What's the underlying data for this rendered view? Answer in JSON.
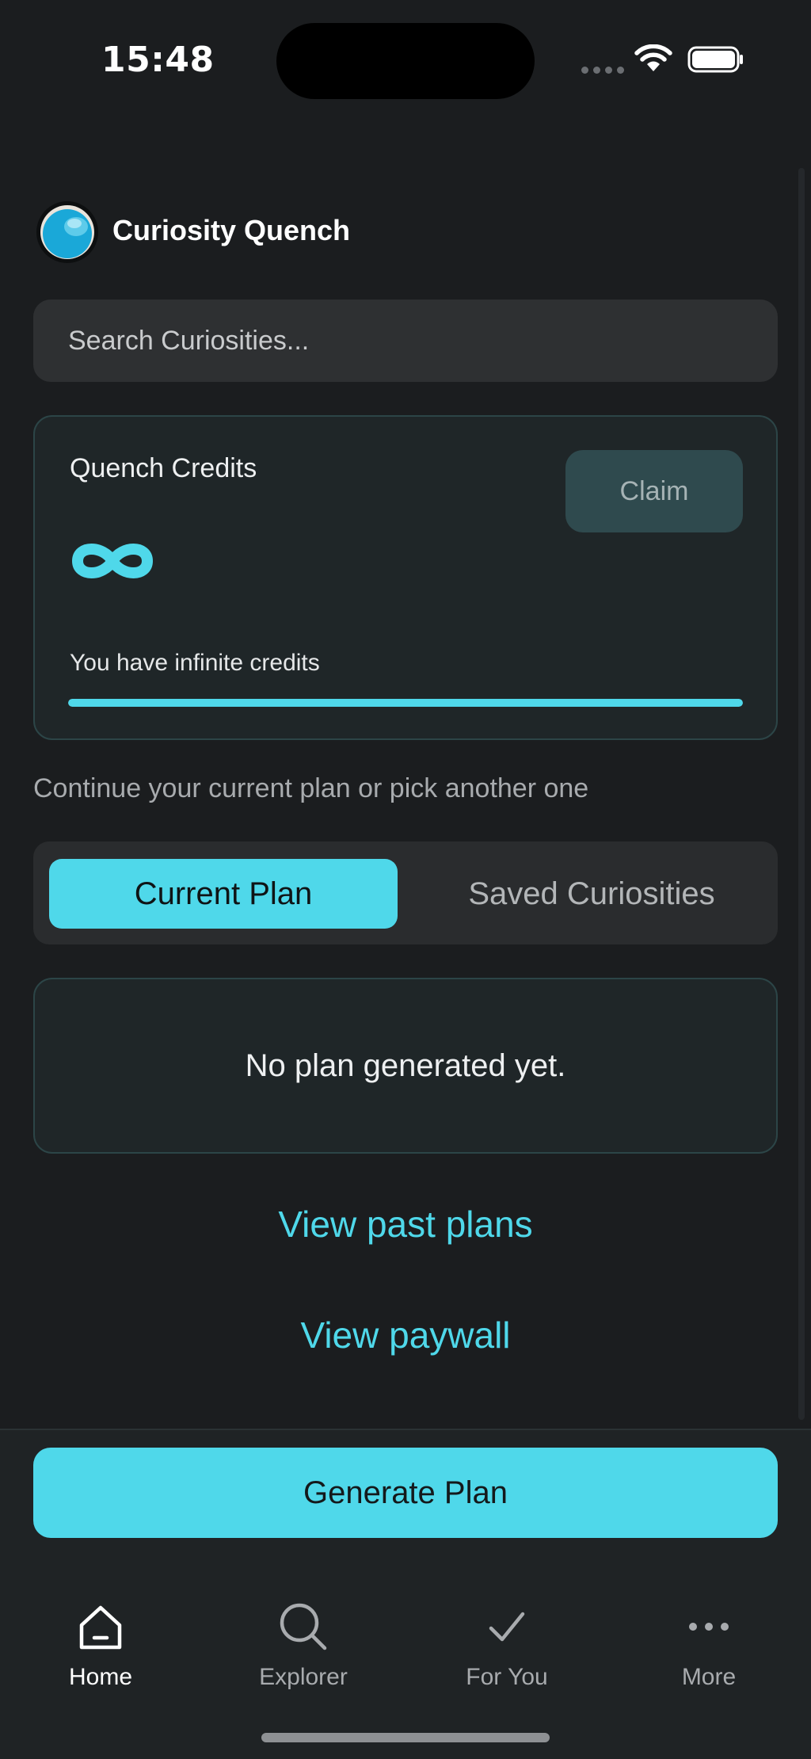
{
  "status_bar": {
    "time": "15:48"
  },
  "header": {
    "app_name": "Curiosity Quench",
    "logo_icon": "water-drop-icon"
  },
  "search": {
    "placeholder": "Search Curiosities..."
  },
  "credits": {
    "label": "Quench Credits",
    "claim_label": "Claim",
    "symbol_icon": "infinity-icon",
    "status_text": "You have infinite credits",
    "progress_fraction": 1.0
  },
  "plan_section": {
    "subtitle": "Continue your current plan or pick another one",
    "tabs": [
      {
        "label": "Current Plan",
        "active": true
      },
      {
        "label": "Saved Curiosities",
        "active": false
      }
    ],
    "empty_message": "No plan generated yet."
  },
  "links": {
    "past_plans": "View past plans",
    "paywall": "View paywall"
  },
  "actions": {
    "generate_label": "Generate Plan"
  },
  "nav": {
    "items": [
      {
        "label": "Home",
        "icon": "home-icon",
        "active": true
      },
      {
        "label": "Explorer",
        "icon": "search-icon",
        "active": false
      },
      {
        "label": "For You",
        "icon": "checkmark-icon",
        "active": false
      },
      {
        "label": "More",
        "icon": "more-dots-icon",
        "active": false
      }
    ]
  },
  "colors": {
    "accent": "#4fd8ea",
    "background": "#1b1d1f",
    "card_border": "#2c4547"
  }
}
